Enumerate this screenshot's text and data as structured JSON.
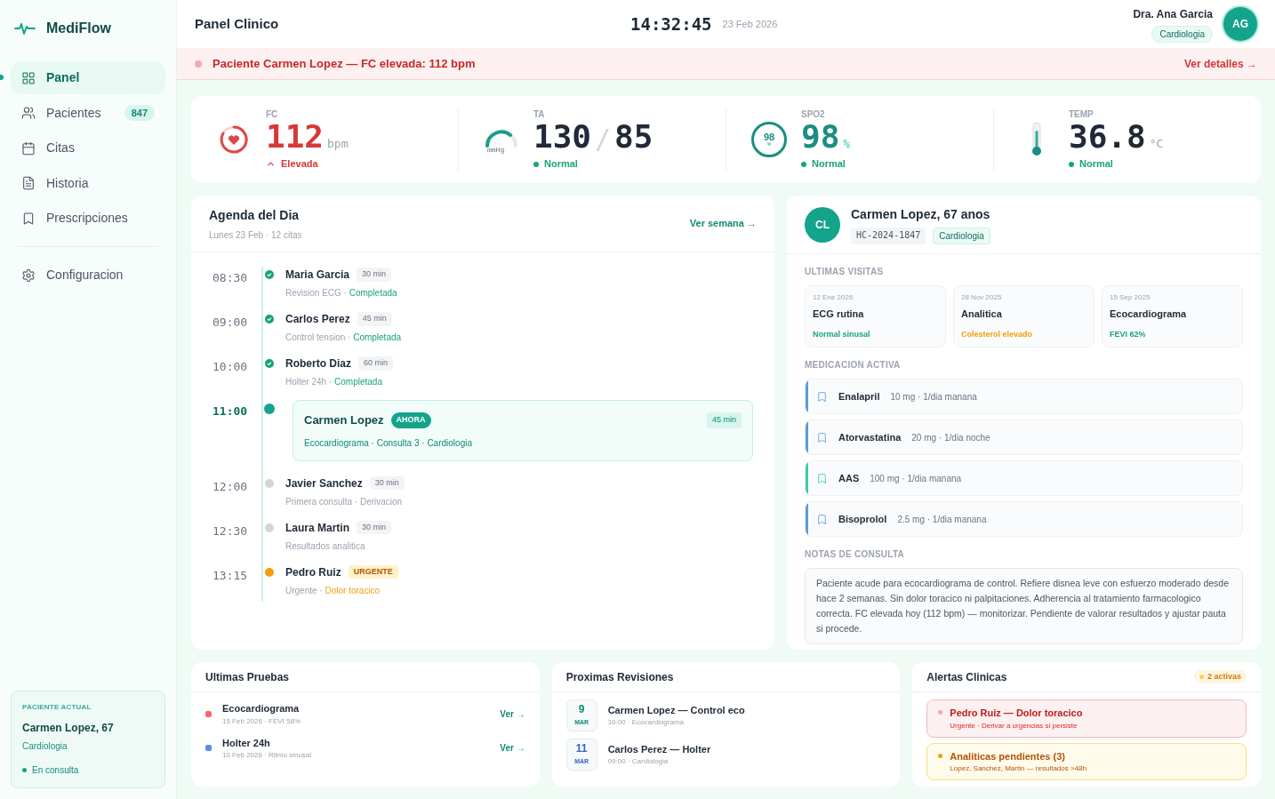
{
  "brand": {
    "name": "MediFlow"
  },
  "nav": [
    {
      "label": "Panel",
      "selected": true
    },
    {
      "label": "Pacientes",
      "selected": false,
      "badge": "847"
    },
    {
      "label": "Citas",
      "selected": false
    },
    {
      "label": "Historia",
      "selected": false
    },
    {
      "label": "Prescripciones",
      "selected": false
    }
  ],
  "nav_bottom": [
    {
      "label": "Configuracion",
      "selected": false
    }
  ],
  "current_patient": {
    "label": "PACIENTE ACTUAL",
    "name": "Carmen Lopez, 67",
    "specialty": "Cardiologia",
    "status": "En consulta"
  },
  "header": {
    "title": "Panel Clinico",
    "time": "14:32:45",
    "date": "23 Feb 2026",
    "user": "Dra. Ana Garcia",
    "user_role": "Cardiologia",
    "initials": "AG"
  },
  "alert_bar": {
    "message": "Paciente Carmen Lopez — FC elevada: 112 bpm",
    "link": "Ver detalles →"
  },
  "vitals": [
    {
      "kind": "fc",
      "label": "FC",
      "value": "112",
      "unit": "bpm",
      "status": "Elevada",
      "elevated": true
    },
    {
      "kind": "ta",
      "label": "TA",
      "value": "130",
      "value2": "85",
      "separator": "/",
      "gauge_unit": "mmHg",
      "status": "Normal",
      "elevated": false
    },
    {
      "kind": "spo2",
      "label": "SPO2",
      "value": "98",
      "unit": "%",
      "ring_value": "98",
      "ring_unit": "%",
      "status": "Normal",
      "elevated": false
    },
    {
      "kind": "temp",
      "label": "TEMP",
      "value": "36.8",
      "unit": "°C",
      "status": "Normal",
      "elevated": false
    }
  ],
  "agenda": {
    "title": "Agenda del Dia",
    "subtitle": "Lunes 23 Feb · 12 citas",
    "link": "Ver semana →",
    "items": [
      {
        "time": "08:30",
        "name": "Maria Garcia",
        "duration": "30 min",
        "kind": "done",
        "detail": "Revision ECG ·",
        "note": "Completada"
      },
      {
        "time": "09:00",
        "name": "Carlos Perez",
        "duration": "45 min",
        "kind": "done",
        "detail": "Control tension ·",
        "note": "Completada"
      },
      {
        "time": "10:00",
        "name": "Roberto Diaz",
        "duration": "60 min",
        "kind": "done",
        "detail": "Holter 24h ·",
        "note": "Completada"
      },
      {
        "time": "11:00",
        "name": "Carmen Lopez",
        "duration": "45 min",
        "kind": "current",
        "tag": "AHORA",
        "detail": "Ecocardiograma · Consulta 3 · Cardiologia"
      },
      {
        "time": "12:00",
        "name": "Javier Sanchez",
        "duration": "30 min",
        "kind": "pending",
        "detail": "Primera consulta · Derivacion"
      },
      {
        "time": "12:30",
        "name": "Laura Martin",
        "duration": "30 min",
        "kind": "pending",
        "detail": "Resultados analitica"
      },
      {
        "time": "13:15",
        "name": "Pedro Ruiz",
        "kind": "urgent",
        "tag": "URGENTE",
        "detail": "Urgente ·",
        "note": "Dolor toracico"
      }
    ]
  },
  "patient": {
    "initials": "CL",
    "name": "Carmen Lopez, 67 anos",
    "record": "HC-2024-1847",
    "specialty": "Cardiologia",
    "visits_title": "ULTIMAS VISITAS",
    "visits": [
      {
        "date": "12 Ene 2026",
        "title": "ECG rutina",
        "result": "Normal sinusal",
        "color": "#18a37a"
      },
      {
        "date": "28 Nov 2025",
        "title": "Analitica",
        "result": "Colesterol elevado",
        "color": "#f59e0b"
      },
      {
        "date": "15 Sep 2025",
        "title": "Ecocardiograma",
        "result": "FEVI 62%",
        "color": "#18a37a"
      }
    ],
    "meds_title": "MEDICACION ACTIVA",
    "meds": [
      {
        "name": "Enalapril",
        "dose": "10 mg · 1/dia manana",
        "color": "#5b9be0"
      },
      {
        "name": "Atorvastatina",
        "dose": "20 mg · 1/dia noche",
        "color": "#5b9be0"
      },
      {
        "name": "AAS",
        "dose": "100 mg · 1/dia manana",
        "color": "#3cc9a8"
      },
      {
        "name": "Bisoprolol",
        "dose": "2.5 mg · 1/dia manana",
        "color": "#5b9be0"
      }
    ],
    "notes_title": "NOTAS DE CONSULTA",
    "notes": "Paciente acude para ecocardiograma de control. Refiere disnea leve con esfuerzo moderado desde hace 2 semanas. Sin dolor toracico ni palpitaciones. Adherencia al tratamiento farmacologico correcta. FC elevada hoy (112 bpm) — monitorizar. Pendiente de valorar resultados y ajustar pauta si procede."
  },
  "tests": {
    "title": "Ultimas Pruebas",
    "items": [
      {
        "name": "Ecocardiograma",
        "meta": "15 Feb 2026 · FEVI 58%",
        "link": "Ver →",
        "color": "#ef6b6b"
      },
      {
        "name": "Holter 24h",
        "meta": "10 Feb 2026 · Ritmo sinusal",
        "link": "Ver →",
        "color": "#5b8def"
      }
    ]
  },
  "reviews": {
    "title": "Proximas Revisiones",
    "items": [
      {
        "day": "9",
        "month": "MAR",
        "title": "Carmen Lopez — Control eco",
        "meta": "10:00 · Ecocardiograma",
        "color": "#0f8a75"
      },
      {
        "day": "11",
        "month": "MAR",
        "title": "Carlos Perez — Holter",
        "meta": "09:00 · Cardiologia",
        "color": "#2f62d1"
      }
    ]
  },
  "clinical_alerts": {
    "title": "Alertas Clinicas",
    "count": "2 activas",
    "items": [
      {
        "title": "Pedro Ruiz — Dolor toracico",
        "detail": "Urgente · Derivar a urgencias si persiste",
        "kind": "danger"
      },
      {
        "title": "Analiticas pendientes (3)",
        "detail": "Lopez, Sanchez, Martin — resultados >48h",
        "kind": "warning"
      }
    ]
  }
}
